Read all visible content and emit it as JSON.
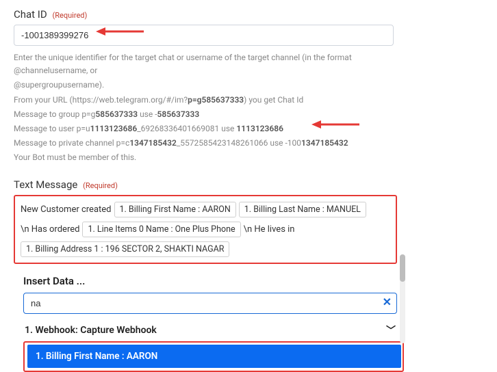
{
  "chat_id": {
    "label": "Chat ID",
    "required_text": "(Required)",
    "value": "-1001389399276",
    "help": {
      "line1_a": "Enter the unique identifier for the target chat or username of the target channel (in the format @channelusername, or",
      "line1_b": "@supergroupusername).",
      "line2_a": "From your URL (https://web.telegram.org/#/im?",
      "line2_b": "p=g585637333",
      "line2_c": ") you get Chat Id",
      "line3_a": "Message to group p=g",
      "line3_b": "585637333",
      "line3_c": " use -",
      "line3_d": "585637333",
      "line4_a": "Message to user p=u",
      "line4_b": "1113123686",
      "line4_c": "_69268336401669081 use ",
      "line4_d": "1113123686",
      "line5_a": "Message to private channel p=c",
      "line5_b": "1347185432",
      "line5_c": "_5572585423148261066 use -100",
      "line5_d": "1347185432",
      "line6": "Your Bot must be member of this."
    }
  },
  "text_message": {
    "label": "Text Message",
    "required_text": "(Required)",
    "parts": {
      "t1": "New Customer created",
      "c1": "1. Billing First Name : AARON",
      "c2": "1. Billing Last Name : MANUEL",
      "t2": "\\n Has ordered",
      "c3": "1. Line Items 0 Name : One Plus Phone",
      "t3": "\\n He lives in",
      "c4": "1. Billing Address 1 : 196 SECTOR 2, SHAKTI NAGAR"
    }
  },
  "insert": {
    "title": "Insert Data ...",
    "search_value": "na",
    "webhook_header": "1. Webhook: Capture Webhook",
    "item1": "1. Billing First Name : AARON"
  }
}
